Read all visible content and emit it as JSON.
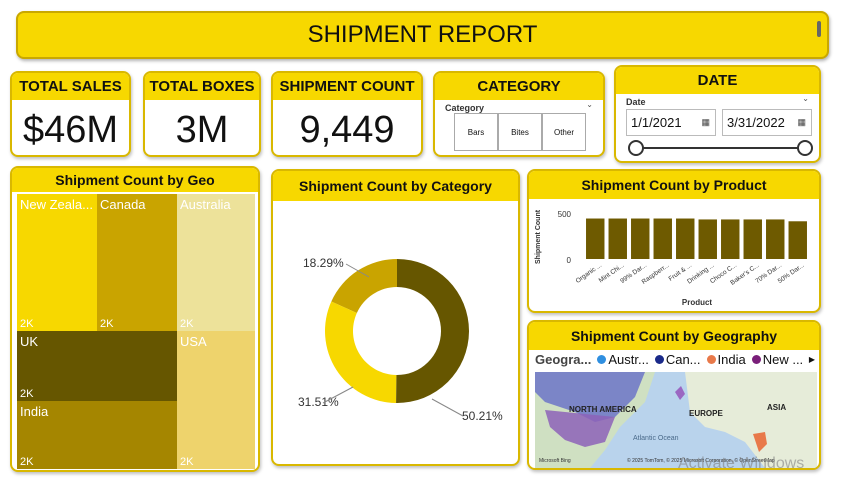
{
  "title": "SHIPMENT REPORT",
  "kpis": [
    {
      "label": "TOTAL SALES",
      "value": "$46M"
    },
    {
      "label": "TOTAL BOXES",
      "value": "3M"
    },
    {
      "label": "SHIPMENT COUNT",
      "value": "9,449"
    }
  ],
  "category_slicer": {
    "header": "CATEGORY",
    "field_label": "Category",
    "options": [
      "Bars",
      "Bites",
      "Other"
    ]
  },
  "date_slicer": {
    "header": "DATE",
    "field_label": "Date",
    "start": "1/1/2021",
    "end": "3/31/2022"
  },
  "treemap": {
    "title": "Shipment Count by Geo",
    "tiles": [
      {
        "label": "New Zeala...",
        "value": "2K",
        "color": "#f7d800"
      },
      {
        "label": "Canada",
        "value": "2K",
        "color": "#c9a400"
      },
      {
        "label": "Australia",
        "value": "2K",
        "color": "#ede29a"
      },
      {
        "label": "UK",
        "value": "2K",
        "color": "#665600"
      },
      {
        "label": "USA",
        "value": "2K",
        "color": "#eed36c"
      },
      {
        "label": "India",
        "value": "2K",
        "color": "#a58600"
      }
    ]
  },
  "donut": {
    "title": "Shipment Count by Category",
    "labels": [
      "50.21%",
      "31.51%",
      "18.29%"
    ]
  },
  "product_chart": {
    "title": "Shipment Count by Product",
    "ylabel": "Shipment Count",
    "xlabel": "Product",
    "y_tick": "500",
    "y_zero": "0",
    "categories": [
      "Organic ...",
      "Mint Chi...",
      "99% Dar...",
      "Raspberr...",
      "Fruit & ...",
      "Drinking ...",
      "Choco C...",
      "Baker's C...",
      "70% Dar...",
      "50% Dar..."
    ]
  },
  "map": {
    "title": "Shipment Count by Geography",
    "legend_title": "Geogra...",
    "legend": [
      {
        "name": "Austr...",
        "color": "#2f8fe0"
      },
      {
        "name": "Can...",
        "color": "#1a2a8a"
      },
      {
        "name": "India",
        "color": "#e8794a"
      },
      {
        "name": "New ...",
        "color": "#7a1f7a"
      }
    ],
    "labels": {
      "na": "NORTH AMERICA",
      "eu": "EUROPE",
      "as": "ASIA",
      "ocean": "Atlantic Ocean"
    },
    "attribution": "© 2025 TomTom, © 2025 Microsoft Corporation, © OpenStreetMap",
    "bing": "Microsoft Bing"
  },
  "watermark": "Activate Windows",
  "chart_data": [
    {
      "type": "pie",
      "title": "Shipment Count by Category",
      "values": [
        50.21,
        31.51,
        18.29
      ],
      "colors": [
        "#665600",
        "#f7d800",
        "#c9a400"
      ]
    },
    {
      "type": "bar",
      "title": "Shipment Count by Product",
      "xlabel": "Product",
      "ylabel": "Shipment Count",
      "categories": [
        "Organic ...",
        "Mint Chi...",
        "99% Dar...",
        "Raspberr...",
        "Fruit & ...",
        "Drinking ...",
        "Choco C...",
        "Baker's C...",
        "70% Dar...",
        "50% Dar..."
      ],
      "values": [
        440,
        440,
        440,
        440,
        440,
        430,
        430,
        430,
        430,
        410
      ],
      "ylim": [
        0,
        500
      ],
      "color": "#6e5a00"
    }
  ]
}
